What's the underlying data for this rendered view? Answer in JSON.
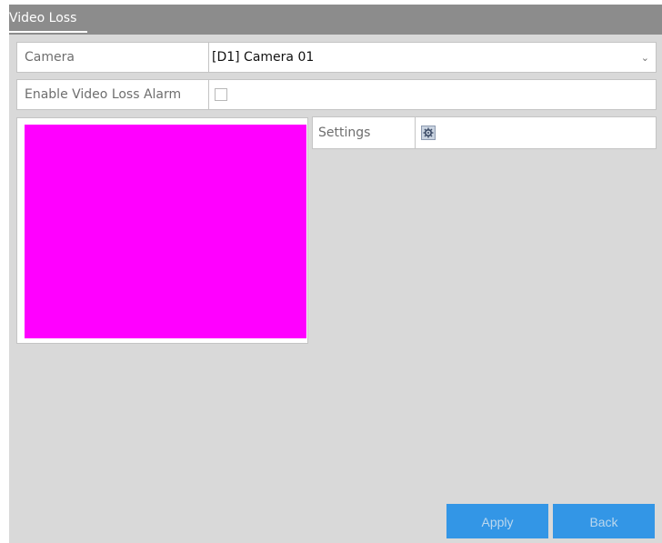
{
  "tab": {
    "label": "Video Loss"
  },
  "form": {
    "camera": {
      "label": "Camera",
      "value": "[D1] Camera 01"
    },
    "enable_alarm": {
      "label": "Enable Video Loss Alarm",
      "checked": false
    },
    "settings": {
      "label": "Settings",
      "icon": "gear-icon"
    }
  },
  "preview": {
    "color": "#ff00ff"
  },
  "buttons": {
    "apply": "Apply",
    "back": "Back"
  },
  "colors": {
    "accent": "#3396e6",
    "titlebar": "#8c8c8c"
  }
}
